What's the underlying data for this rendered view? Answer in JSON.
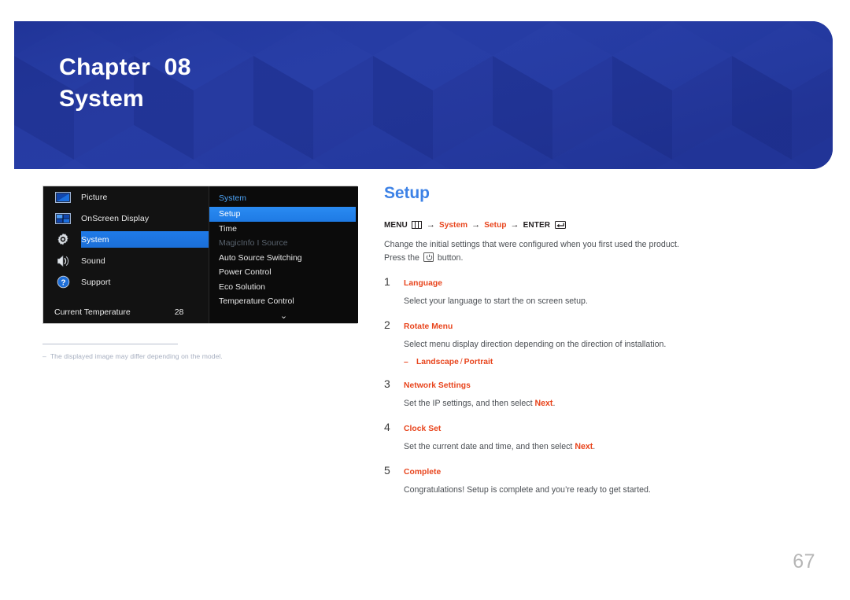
{
  "header": {
    "chapter_label": "Chapter  08",
    "chapter_title": "System",
    "bg_color": "#22379c",
    "text_color": "#ffffff"
  },
  "osd": {
    "categories": [
      {
        "label": "Picture",
        "icon": "picture-icon",
        "active": false
      },
      {
        "label": "OnScreen Display",
        "icon": "onscreen-display-icon",
        "active": false
      },
      {
        "label": "System",
        "icon": "gear-icon",
        "active": true
      },
      {
        "label": "Sound",
        "icon": "speaker-icon",
        "active": false
      },
      {
        "label": "Support",
        "icon": "question-mark-icon",
        "active": false
      }
    ],
    "temperature": {
      "label": "Current Temperature",
      "value": "28"
    },
    "panel_title": "System",
    "submenu": [
      {
        "label": "Setup",
        "state": "selected"
      },
      {
        "label": "Time",
        "state": "normal"
      },
      {
        "label": "MagicInfo I Source",
        "state": "disabled"
      },
      {
        "label": "Auto Source Switching",
        "state": "normal"
      },
      {
        "label": "Power Control",
        "state": "normal"
      },
      {
        "label": "Eco Solution",
        "state": "normal"
      },
      {
        "label": "Temperature Control",
        "state": "normal"
      }
    ],
    "scroll_indicator": "⌄",
    "highlight_color": "#1f7ae8",
    "panel_title_color": "#4da3f5"
  },
  "footnote": {
    "dash": "‒",
    "text": "The displayed image may differ depending on the model."
  },
  "content": {
    "section_title": "Setup",
    "section_title_color": "#3d82e6",
    "accent_color": "#e8441c",
    "breadcrumb": {
      "menu_label": "MENU",
      "menu_icon": "menu-bars-icon",
      "arrow": "→",
      "crumb1": "System",
      "crumb2": "Setup",
      "enter_label": "ENTER",
      "enter_icon": "enter-arrow-icon"
    },
    "intro_line1": "Change the initial settings that were configured when you first used the product.",
    "intro_pre": "Press the",
    "intro_icon": "power-button-icon",
    "intro_post": "button.",
    "steps": [
      {
        "num": "1",
        "name": "Language",
        "desc_pre": "Select your language to start the on screen setup.",
        "desc_hot": "",
        "desc_post": ""
      },
      {
        "num": "2",
        "name": "Rotate Menu",
        "desc_pre": "Select menu display direction depending on the direction of installation.",
        "desc_hot": "",
        "desc_post": "",
        "bullet": {
          "dash": "–",
          "option1": "Landscape",
          "separator": "/",
          "option2": "Portrait"
        }
      },
      {
        "num": "3",
        "name": "Network Settings",
        "desc_pre": "Set the IP settings, and then select ",
        "desc_hot": "Next",
        "desc_post": "."
      },
      {
        "num": "4",
        "name": "Clock Set",
        "desc_pre": "Set the current date and time, and then select ",
        "desc_hot": "Next",
        "desc_post": "."
      },
      {
        "num": "5",
        "name": "Complete",
        "desc_pre": "Congratulations! Setup is complete and you’re ready to get started.",
        "desc_hot": "",
        "desc_post": ""
      }
    ]
  },
  "page_number": "67"
}
